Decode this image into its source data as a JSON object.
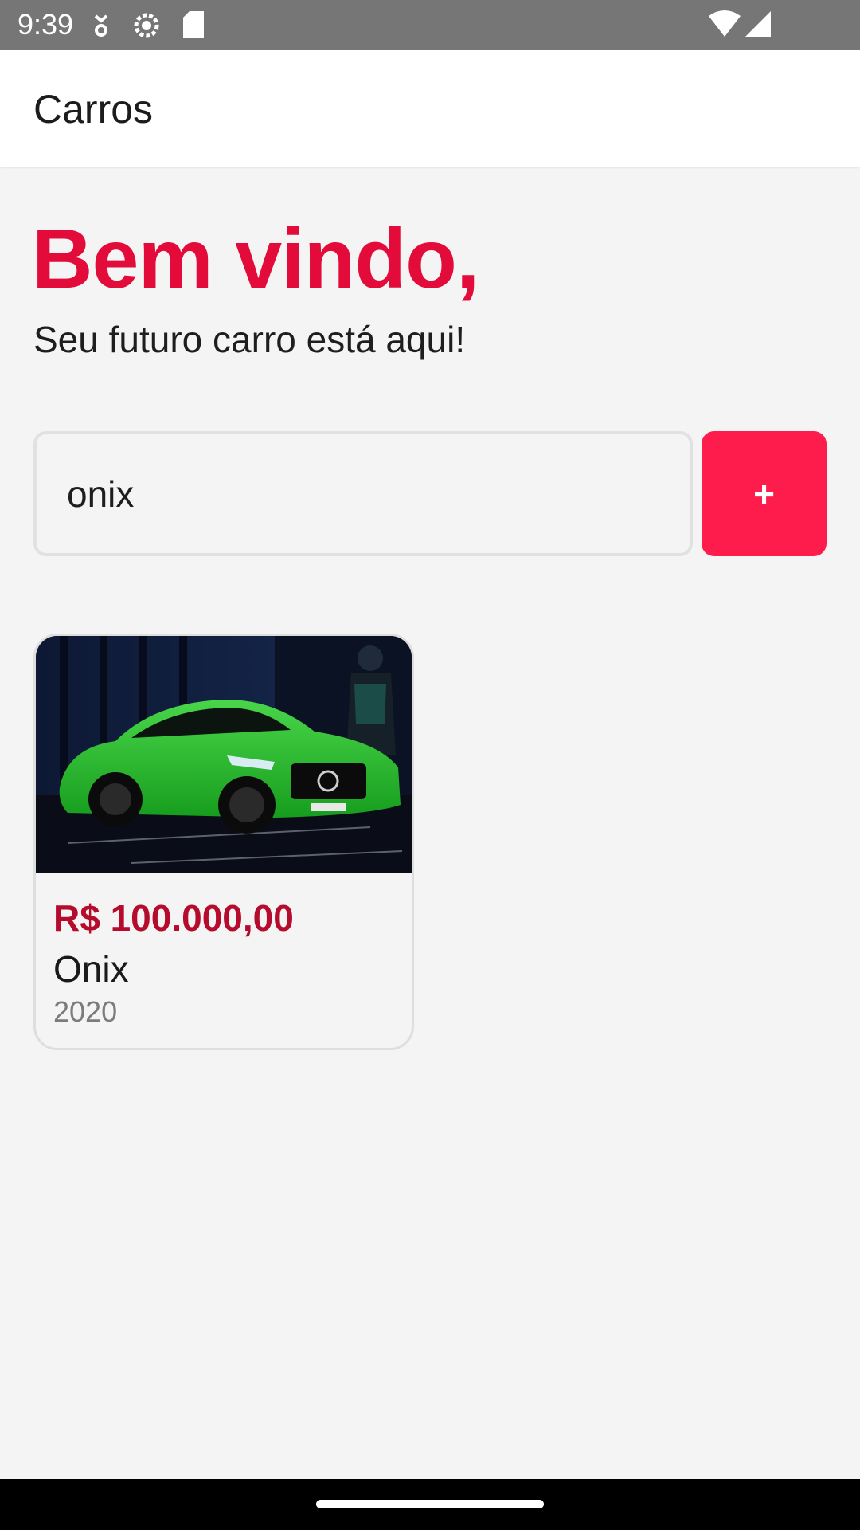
{
  "status_bar": {
    "time": "9:39",
    "icons": [
      "usb-debug-icon",
      "settings-gear-icon",
      "sd-card-icon",
      "wifi-icon",
      "cell-signal-icon"
    ]
  },
  "app_bar": {
    "title": "Carros"
  },
  "hero": {
    "title": "Bem vindo,",
    "subtitle": "Seu futuro carro está aqui!"
  },
  "search": {
    "value": "onix",
    "add_label": "+"
  },
  "cars": [
    {
      "image": "green sports car",
      "price": "R$ 100.000,00",
      "name": "Onix",
      "year": "2020"
    }
  ],
  "colors": {
    "accent": "#e30b3a",
    "button": "#fd1c4b",
    "price": "#b50b2d",
    "background": "#f4f4f4",
    "status_bar": "#767676"
  }
}
